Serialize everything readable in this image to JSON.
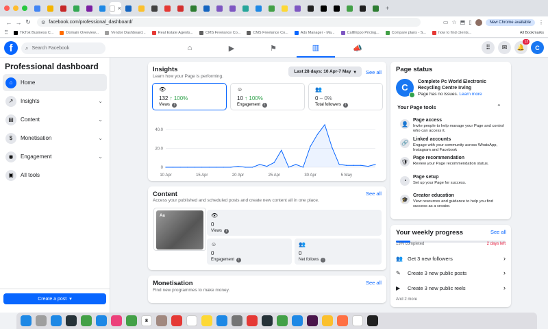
{
  "browser": {
    "tab_colors": [
      "#4285f4",
      "#f4b400",
      "#c62828",
      "#34a853",
      "#7b1fa2",
      "#1e88e5",
      "#ffffff",
      "#1565c0",
      "#fbc02d",
      "#424242",
      "#e53935",
      "#d32f2f",
      "#2e7d32",
      "#1565c0",
      "#7e57c2",
      "#7e57c2",
      "#26a69a",
      "#1e88e5",
      "#43a047",
      "#fdd835",
      "#7e57c2",
      "#212121",
      "#000000",
      "#000000",
      "#43a047",
      "#212121",
      "#2e7d32"
    ],
    "address": "facebook.com/professional_dashboard/",
    "update_label": "New Chrome available",
    "all_bookmarks": "All Bookmarks",
    "bookmarks": [
      {
        "label": "TikTok Business C...",
        "color": "#000000"
      },
      {
        "label": "Domain Overview...",
        "color": "#ff6d00"
      },
      {
        "label": "Vendor Dashboard...",
        "color": "#9e9e9e"
      },
      {
        "label": "Real Estate Agents...",
        "color": "#e53935"
      },
      {
        "label": "CMS Freelance Co...",
        "color": "#616161"
      },
      {
        "label": "CMS Freelance Co...",
        "color": "#616161"
      },
      {
        "label": "Ads Manager - Ma...",
        "color": "#0866ff"
      },
      {
        "label": "Calllhippo Pricing...",
        "color": "#7e57c2"
      },
      {
        "label": "Compare plans - S...",
        "color": "#43a047"
      },
      {
        "label": "how to find clients...",
        "color": "#e53935"
      }
    ]
  },
  "fb": {
    "search_placeholder": "Search Facebook",
    "notif_count": "13",
    "avatar_letter": "C"
  },
  "sidebar": {
    "title": "Professional dashboard",
    "items": [
      {
        "label": "Home",
        "icon": "home-icon"
      },
      {
        "label": "Insights",
        "icon": "insights-icon"
      },
      {
        "label": "Content",
        "icon": "content-icon"
      },
      {
        "label": "Monetisation",
        "icon": "monetisation-icon"
      },
      {
        "label": "Engagement",
        "icon": "engagement-icon"
      },
      {
        "label": "All tools",
        "icon": "tools-icon"
      }
    ],
    "create_post": "Create a post"
  },
  "insights": {
    "title": "Insights",
    "subtitle": "Learn how your Page is performing.",
    "date_range": "Last 28 days: 10 Apr-7 May",
    "see_all": "See all",
    "metrics": [
      {
        "value": "132",
        "change": "↑ 100%",
        "label": "Views"
      },
      {
        "value": "10",
        "change": "↑ 100%",
        "label": "Engagement"
      },
      {
        "value": "0",
        "change": "– 0%",
        "label": "Total followers"
      }
    ]
  },
  "chart_data": {
    "type": "area",
    "x": [
      "10 Apr",
      "11 Apr",
      "12 Apr",
      "13 Apr",
      "14 Apr",
      "15 Apr",
      "16 Apr",
      "17 Apr",
      "18 Apr",
      "19 Apr",
      "20 Apr",
      "21 Apr",
      "22 Apr",
      "23 Apr",
      "24 Apr",
      "25 Apr",
      "26 Apr",
      "27 Apr",
      "28 Apr",
      "29 Apr",
      "30 Apr",
      "1 May",
      "2 May",
      "3 May",
      "4 May",
      "5 May",
      "6 May",
      "7 May"
    ],
    "values": [
      0,
      0,
      0,
      0,
      0,
      0,
      0,
      0,
      0,
      0,
      1,
      0,
      0,
      3,
      1,
      5,
      18,
      0,
      3,
      0,
      22,
      35,
      45,
      21,
      3,
      2,
      2,
      2,
      1,
      3
    ],
    "x_ticks": [
      "10 Apr",
      "15 Apr",
      "20 Apr",
      "25 Apr",
      "30 Apr",
      "5 May"
    ],
    "y_ticks": [
      "0",
      "20.0",
      "40.0"
    ],
    "ylim": [
      0,
      45
    ],
    "color": "#0866ff",
    "grid": true
  },
  "content": {
    "title": "Content",
    "subtitle": "Access your published and scheduled posts and create new content all in one place.",
    "see_all": "See all",
    "thumb_label": "Aa",
    "stats": [
      {
        "value": "0",
        "label": "Views"
      },
      {
        "value": "0",
        "label": "Engagement"
      },
      {
        "value": "0",
        "label": "Net follows"
      }
    ]
  },
  "monetisation": {
    "title": "Monetisation",
    "subtitle": "Find new programmes to make money.",
    "see_all": "See all"
  },
  "page_status": {
    "title": "Page status",
    "avatar_letter": "C",
    "page_name": "Complete Pc World Electronic Recycling Centre Irving",
    "status_text": "Page has no issues.",
    "learn_more": "Learn more",
    "tools_title": "Your Page tools",
    "tools": [
      {
        "name": "Page access",
        "desc": "Invite people to help manage your Page and control who can access it.",
        "icon": "person-icon",
        "color": "#e4e6eb"
      },
      {
        "name": "Linked accounts",
        "desc": "Engage with your community across WhatsApp, Instagram and Facebook",
        "icon": "link-icon",
        "color": "#e4e6eb"
      },
      {
        "name": "Page recommendation",
        "desc": "Review your Page recommendation status.",
        "icon": "shield-icon",
        "color": "#e4e6eb"
      },
      {
        "name": "Page setup",
        "desc": "Set up your Page for success.",
        "icon": "setup-icon",
        "color": "#e4e6eb"
      },
      {
        "name": "Creator education",
        "desc": "View resources and guidance to help you find success as a creator.",
        "icon": "graduation-icon",
        "color": "#e4e6eb"
      }
    ]
  },
  "weekly": {
    "title": "Your weekly progress",
    "see_all": "See all",
    "completed": "13% completed",
    "progress": 0.13,
    "days_left": "2 days left",
    "items": [
      {
        "label": "Get 3 new followers",
        "icon": "followers-icon"
      },
      {
        "label": "Create 3 new public posts",
        "icon": "post-icon"
      },
      {
        "label": "Create 3 new public reels",
        "icon": "reels-icon"
      }
    ],
    "more": "And 2 more"
  },
  "dock": {
    "apps": [
      {
        "name": "finder-icon",
        "color": "#1e88e5"
      },
      {
        "name": "launchpad-icon",
        "color": "#9e9e9e"
      },
      {
        "name": "safari-icon",
        "color": "#1e88e5"
      },
      {
        "name": "app-icon",
        "color": "#263238"
      },
      {
        "name": "messages-icon",
        "color": "#43a047"
      },
      {
        "name": "mail-icon",
        "color": "#1e88e5"
      },
      {
        "name": "photos-icon",
        "color": "#ec407a"
      },
      {
        "name": "facetime-icon",
        "color": "#43a047"
      },
      {
        "name": "calendar-icon",
        "color": "#ffffff"
      },
      {
        "name": "contacts-icon",
        "color": "#a1887f"
      },
      {
        "name": "app-icon",
        "color": "#e53935"
      },
      {
        "name": "reminders-icon",
        "color": "#ffffff"
      },
      {
        "name": "notes-icon",
        "color": "#fdd835"
      },
      {
        "name": "appstore-icon",
        "color": "#1e88e5"
      },
      {
        "name": "settings-icon",
        "color": "#757575"
      },
      {
        "name": "youtube-icon",
        "color": "#e53935"
      },
      {
        "name": "app-icon",
        "color": "#263238"
      },
      {
        "name": "whatsapp-icon",
        "color": "#43a047"
      },
      {
        "name": "docker-icon",
        "color": "#1e88e5"
      },
      {
        "name": "slack-icon",
        "color": "#4a154b"
      },
      {
        "name": "chrome-icon",
        "color": "#fbc02d"
      },
      {
        "name": "app-icon",
        "color": "#ff7043"
      },
      {
        "name": "app-icon",
        "color": "#ffffff"
      },
      {
        "name": "terminal-icon",
        "color": "#212121"
      }
    ],
    "calendar_day": "8"
  }
}
